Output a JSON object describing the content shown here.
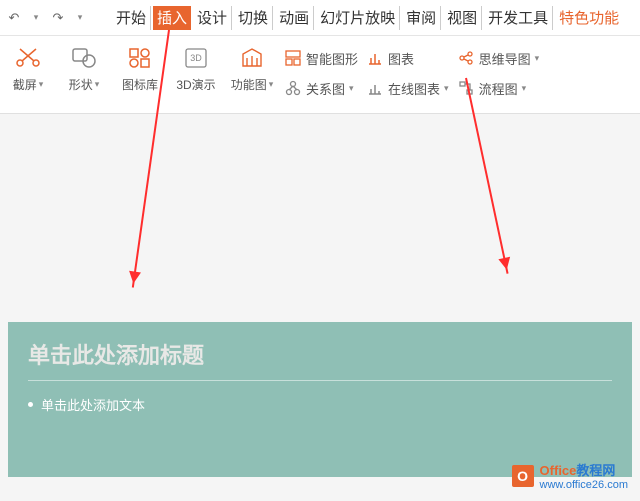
{
  "tabs": {
    "start": "开始",
    "insert": "插入",
    "design": "设计",
    "transition": "切换",
    "animation": "动画",
    "slideshow": "幻灯片放映",
    "review": "审阅",
    "view": "视图",
    "dev": "开发工具",
    "special": "特色功能"
  },
  "ribbon": {
    "capture": "截屏",
    "shapes": "形状",
    "icons": "图标库",
    "demo3d": "3D演示",
    "funcchart": "功能图",
    "smartshape": "智能图形",
    "relation": "关系图",
    "chart": "图表",
    "onlinechart": "在线图表",
    "mindmap": "思维导图",
    "flowchart": "流程图"
  },
  "slide": {
    "title": "单击此处添加标题",
    "body": "单击此处添加文本"
  },
  "watermark": {
    "brand1": "Office",
    "brand2": "教程网",
    "url": "www.office26.com"
  }
}
